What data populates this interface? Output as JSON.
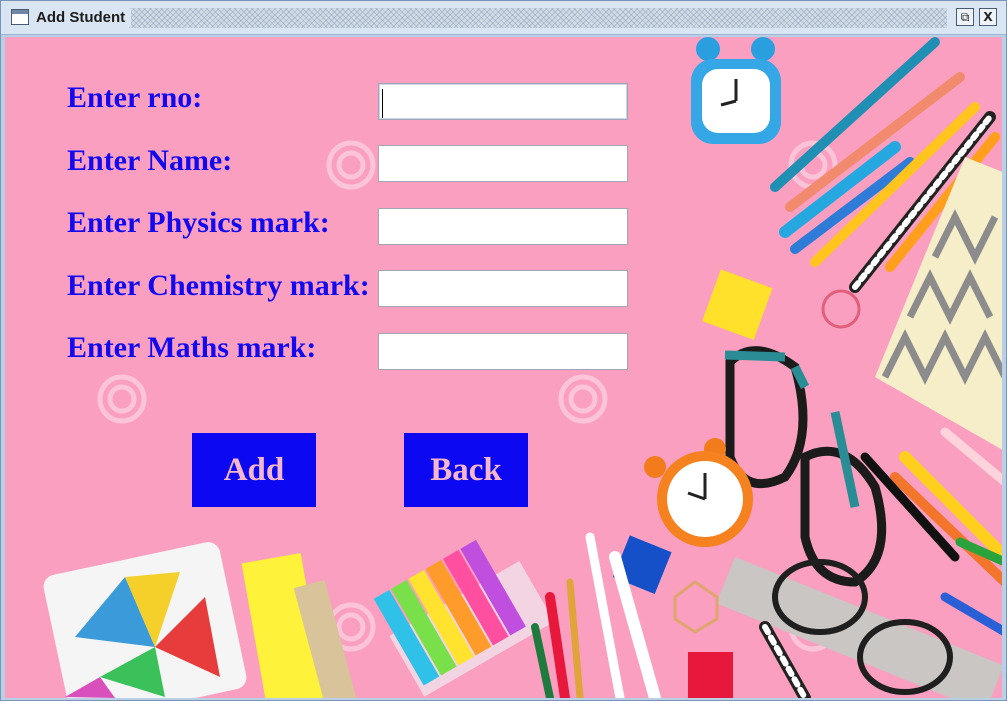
{
  "window": {
    "title": "Add Student",
    "restore_glyph": "⧉",
    "close_glyph": "X"
  },
  "form": {
    "rno_label": "Enter rno:",
    "name_label": "Enter Name:",
    "physics_label": "Enter Physics mark:",
    "chemistry_label": "Enter Chemistry mark:",
    "maths_label": "Enter Maths mark:",
    "rno_value": "",
    "name_value": "",
    "physics_value": "",
    "chemistry_value": "",
    "maths_value": ""
  },
  "buttons": {
    "add_label": "Add",
    "back_label": "Back"
  },
  "icons": {
    "window_icon": "window-icon",
    "restore": "restore-icon",
    "close": "close-icon"
  },
  "colors": {
    "background": "#fa9fc0",
    "label_text": "#1209f0",
    "button_fill": "#0c08f2",
    "button_text": "#f7b7cb"
  }
}
